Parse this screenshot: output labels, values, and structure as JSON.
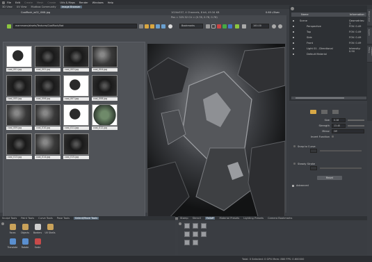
{
  "menubar": {
    "items": [
      {
        "label": "File",
        "dim": false
      },
      {
        "label": "Edit",
        "dim": false
      },
      {
        "label": "Create",
        "dim": true
      },
      {
        "label": "Mesh",
        "dim": true
      },
      {
        "label": "Create",
        "dim": true
      },
      {
        "label": "UVs & Maps",
        "dim": false
      },
      {
        "label": "Render",
        "dim": false
      },
      {
        "label": "Windows",
        "dim": false
      },
      {
        "label": "Help",
        "dim": false
      }
    ]
  },
  "tabs": [
    {
      "label": "3D View",
      "active": false
    },
    {
      "label": "UV View",
      "active": false
    },
    {
      "label": "Mudbox Community",
      "active": false
    },
    {
      "label": "Image Browser",
      "active": true
    }
  ],
  "browser": {
    "title": "CoalRock_w02_i008.jpg",
    "info": "1024x537, 4 Channels, 8 bit, 49.34 KB",
    "pos": "Pos = 325.32   Clr = (0.78, 0.78, 0.78)",
    "zoom": "0.60 r/Ssec",
    "path": "mammoex/aksets/Textures/CoalRock/Nat",
    "bookmarks": "Bookmarks",
    "zoom_value": "100.00"
  },
  "thumbnails": [
    {
      "caption": "coal_001.jpg",
      "tone": "light"
    },
    {
      "caption": "coal_002.jpg",
      "tone": "dark"
    },
    {
      "caption": "coal_003.jpg",
      "tone": "dark"
    },
    {
      "caption": "coal_004.jpg",
      "tone": "mid"
    },
    {
      "caption": "coal_005.jpg",
      "tone": "dark"
    },
    {
      "caption": "coal_006.jpg",
      "tone": "dark"
    },
    {
      "caption": "coal_007.jpg",
      "tone": "light"
    },
    {
      "caption": "coal_008.jpg",
      "tone": "dark"
    },
    {
      "caption": "coal_009.jpg",
      "tone": "mid"
    },
    {
      "caption": "coal_010.jpg",
      "tone": "mid"
    },
    {
      "caption": "coal_011.jpg",
      "tone": "light"
    },
    {
      "caption": "coal_012.jpg",
      "tone": "green"
    },
    {
      "caption": "coal_013.jpg",
      "tone": "dark"
    },
    {
      "caption": "coal_014.jpg",
      "tone": "mid"
    },
    {
      "caption": "coal_015.jpg",
      "tone": "dark"
    }
  ],
  "scene": {
    "header_name": "Name",
    "header_info": "Information",
    "rows": [
      {
        "name": "Scene",
        "value": "Geometries: 1",
        "indent": 0
      },
      {
        "name": "Perspective",
        "value": "FOV: 0.49",
        "indent": 1
      },
      {
        "name": "Top",
        "value": "FOV: 0.49",
        "indent": 1
      },
      {
        "name": "Side",
        "value": "FOV: 0.49",
        "indent": 1
      },
      {
        "name": "Front",
        "value": "FOV: 0.49",
        "indent": 1
      },
      {
        "name": "Light 01 - Directional",
        "value": "Intensity: 0.90",
        "indent": 1
      },
      {
        "name": "Default Material",
        "value": "",
        "indent": 1
      }
    ]
  },
  "sidetabs": [
    "Object List",
    "Layers",
    "Viewport Filters"
  ],
  "props": {
    "size_label": "Size",
    "size_value": "0.18",
    "strength_label": "Strength",
    "strength_value": "13.40",
    "mirror_label": "Mirror",
    "mirror_value": "Off",
    "invert_label": "Invert Function",
    "snap_label": "Snap to Curve",
    "steady_label": "Steady Stroke",
    "reset_label": "Reset",
    "advanced_label": "Advanced"
  },
  "bottom_left": {
    "tabs": [
      {
        "label": "Sculpt Tools",
        "active": false
      },
      {
        "label": "Paint Tools",
        "active": false
      },
      {
        "label": "Curve Tools",
        "active": false
      },
      {
        "label": "Pose Tools",
        "active": false
      },
      {
        "label": "Select/Move Tools",
        "active": true
      }
    ],
    "tools": [
      {
        "label": "Faces"
      },
      {
        "label": "Objects"
      },
      {
        "label": "Borders"
      },
      {
        "label": "UV Shells"
      },
      {
        "label": "Translate"
      },
      {
        "label": "Rotate"
      },
      {
        "label": "Scale"
      }
    ]
  },
  "bottom_right": {
    "tabs": [
      {
        "label": "Stamp",
        "active": false
      },
      {
        "label": "Stencil",
        "active": false
      },
      {
        "label": "Falloff",
        "active": true
      },
      {
        "label": "Material Presets",
        "active": false
      },
      {
        "label": "Lighting Presets",
        "active": false
      },
      {
        "label": "Camera Bookmarks",
        "active": false
      }
    ]
  },
  "status": {
    "text": "Total: 0  Selected: 0  GPU Mem: 880  FPS: 0.600000"
  }
}
